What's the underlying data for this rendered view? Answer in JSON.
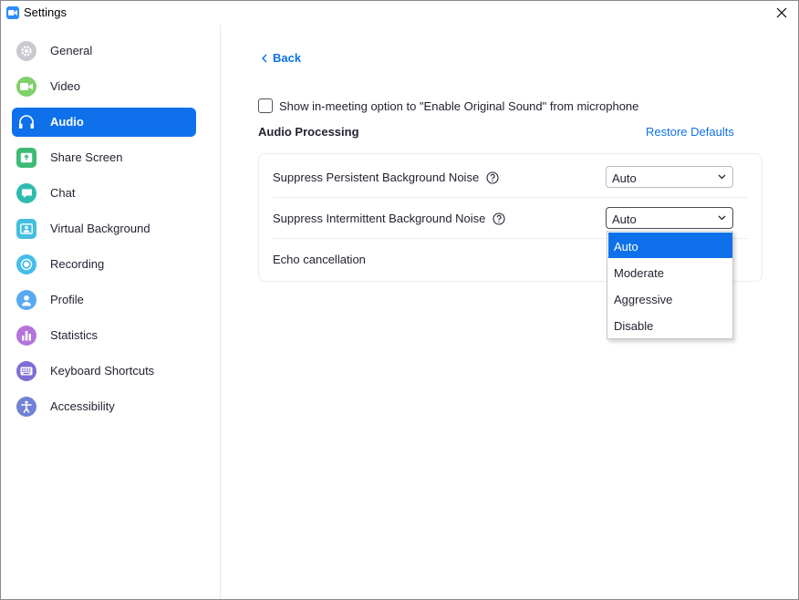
{
  "window": {
    "title": "Settings"
  },
  "sidebar": {
    "items": [
      {
        "label": "General",
        "icon": "gear-icon",
        "color": "#b8b8bf"
      },
      {
        "label": "Video",
        "icon": "video-camera-icon",
        "color": "#6bcb59"
      },
      {
        "label": "Audio",
        "icon": "headphones-icon",
        "color": "#0e71eb",
        "active": true
      },
      {
        "label": "Share Screen",
        "icon": "share-screen-icon",
        "color": "#35b36b"
      },
      {
        "label": "Chat",
        "icon": "chat-bubble-icon",
        "color": "#28b5a6"
      },
      {
        "label": "Virtual Background",
        "icon": "virtual-background-icon",
        "color": "#3fb7d9"
      },
      {
        "label": "Recording",
        "icon": "recording-icon",
        "color": "#3fb7e6"
      },
      {
        "label": "Profile",
        "icon": "profile-icon",
        "color": "#52a6f2"
      },
      {
        "label": "Statistics",
        "icon": "statistics-icon",
        "color": "#b06fd6"
      },
      {
        "label": "Keyboard Shortcuts",
        "icon": "keyboard-icon",
        "color": "#7a6bd1"
      },
      {
        "label": "Accessibility",
        "icon": "accessibility-icon",
        "color": "#6c7fd1"
      }
    ]
  },
  "main": {
    "back_label": "Back",
    "original_sound_checkbox": {
      "label": "Show in-meeting option to \"Enable Original Sound\" from microphone",
      "checked": false
    },
    "section_title": "Audio Processing",
    "restore_defaults_label": "Restore Defaults",
    "rows": [
      {
        "label": "Suppress Persistent Background Noise",
        "value": "Auto"
      },
      {
        "label": "Suppress Intermittent Background Noise",
        "value": "Auto"
      },
      {
        "label": "Echo cancellation"
      }
    ],
    "dropdown": {
      "options": [
        "Auto",
        "Moderate",
        "Aggressive",
        "Disable"
      ],
      "selected": "Auto"
    }
  },
  "colors": {
    "accent": "#0e71eb",
    "text": "#232333",
    "border": "#ededf0"
  }
}
